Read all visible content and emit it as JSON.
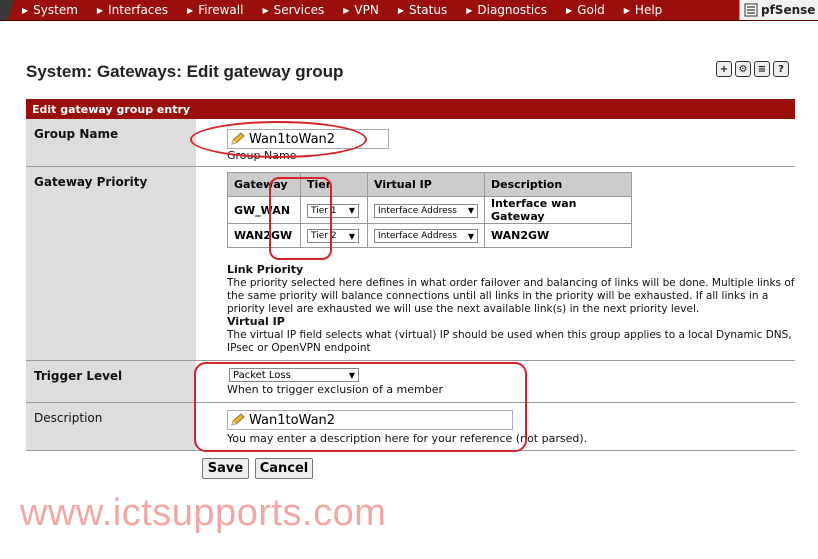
{
  "nav": {
    "items": [
      {
        "label": "System"
      },
      {
        "label": "Interfaces"
      },
      {
        "label": "Firewall"
      },
      {
        "label": "Services"
      },
      {
        "label": "VPN"
      },
      {
        "label": "Status"
      },
      {
        "label": "Diagnostics"
      },
      {
        "label": "Gold"
      },
      {
        "label": "Help"
      }
    ],
    "brand": "pfSense"
  },
  "page": {
    "title": "System: Gateways: Edit gateway group",
    "section_header": "Edit gateway group entry"
  },
  "form": {
    "group_name": {
      "label": "Group Name",
      "value": "Wan1toWan2",
      "hint": "Group Name"
    },
    "gateway_priority": {
      "label": "Gateway Priority",
      "columns": [
        "Gateway",
        "Tier",
        "Virtual IP",
        "Description"
      ],
      "rows": [
        {
          "gateway": "GW_WAN",
          "tier": "Tier 1",
          "vip": "Interface Address",
          "description": "Interface wan Gateway"
        },
        {
          "gateway": "WAN2GW",
          "tier": "Tier 2",
          "vip": "Interface Address",
          "description": "WAN2GW"
        }
      ],
      "link_priority_title": "Link Priority",
      "link_priority_text": "The priority selected here defines in what order failover and balancing of links will be done. Multiple links of the same priority will balance connections until all links in the priority will be exhausted. If all links in a priority level are exhausted we will use the next available link(s) in the next priority level.",
      "virtual_ip_title": "Virtual IP",
      "virtual_ip_text": "The virtual IP field selects what (virtual) IP should be used when this group applies to a local Dynamic DNS, IPsec or OpenVPN endpoint"
    },
    "trigger_level": {
      "label": "Trigger Level",
      "value": "Packet Loss",
      "hint": "When to trigger exclusion of a member"
    },
    "description": {
      "label": "Description",
      "value": "Wan1toWan2",
      "hint": "You may enter a description here for your reference (not parsed)."
    }
  },
  "buttons": {
    "save": "Save",
    "cancel": "Cancel"
  },
  "watermark": "www.ictsupports.com",
  "colors": {
    "nav_bg": "#9a0e0c",
    "annotation": "#d4232a",
    "watermark": "#f2a6a6"
  }
}
